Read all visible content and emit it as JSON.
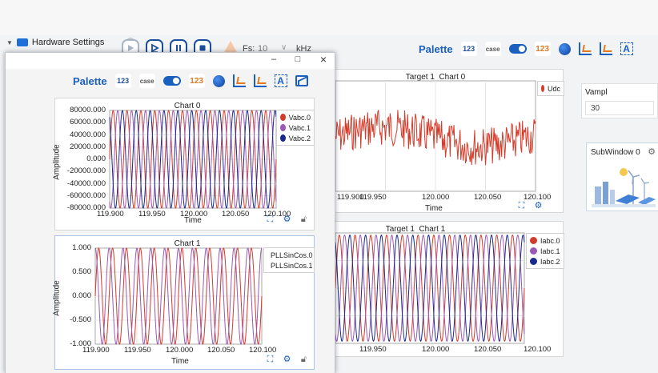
{
  "tree": {
    "label": "Hardware Settings"
  },
  "toolbar": {
    "fs_label": "Fs:",
    "fs_value": "10",
    "fs_unit": "kHz"
  },
  "palette": {
    "title": "Palette",
    "btn_123": "123",
    "btn_case": "case",
    "btn_123o": "123",
    "btn_text": "A"
  },
  "target_chart0": {
    "title": "Target 1_Chart 0",
    "legend": [
      {
        "name": "Udc",
        "color": "#d43b2a"
      }
    ],
    "xticks": [
      "119.900",
      "119.950",
      "120.000",
      "120.050",
      "120.100"
    ],
    "xlabel": "Time"
  },
  "target_chart1": {
    "title": "Target 1_Chart 1",
    "legend": [
      {
        "name": "Iabc.0",
        "color": "#d43b2a"
      },
      {
        "name": "Iabc.1",
        "color": "#9b59b6"
      },
      {
        "name": "Iabc.2",
        "color": "#1a2a8c"
      }
    ],
    "xticks": [
      "119.950",
      "120.000",
      "120.050",
      "120.100"
    ]
  },
  "vampl": {
    "label": "Vampl",
    "value": "30"
  },
  "subwindow": {
    "title": "SubWindow 0"
  },
  "fg_window": {
    "minimize": "–",
    "maximize": "□",
    "close": "×",
    "chart0": {
      "title": "Chart 0",
      "legend": [
        {
          "name": "Vabc.0",
          "color": "#d43b2a"
        },
        {
          "name": "Vabc.1",
          "color": "#9b59b6"
        },
        {
          "name": "Vabc.2",
          "color": "#1a2a8c"
        }
      ],
      "yticks": [
        "80000.000",
        "60000.000",
        "40000.000",
        "20000.000",
        "0.000",
        "-20000.000",
        "-40000.000",
        "-60000.000",
        "-80000.000"
      ],
      "xticks": [
        "119.900",
        "119.950",
        "120.000",
        "120.050",
        "120.100"
      ],
      "xlabel": "Time",
      "ylabel": "Amplitude"
    },
    "chart1": {
      "title": "Chart 1",
      "legend": [
        {
          "name": "PLLSinCos.0",
          "color": "#d43b2a"
        },
        {
          "name": "PLLSinCos.1",
          "color": "#9b59b6"
        }
      ],
      "yticks": [
        "1.000",
        "0.500",
        "0.000",
        "-0.500",
        "-1.000"
      ],
      "xticks": [
        "119.900",
        "119.950",
        "120.000",
        "120.050",
        "120.100"
      ],
      "xlabel": "Time",
      "ylabel": "Amplitude"
    }
  },
  "chart_data": [
    {
      "type": "line",
      "title": "Chart 0",
      "x_range": [
        119.9,
        120.1
      ],
      "ylim": [
        -80000,
        80000
      ],
      "xlabel": "Time",
      "ylabel": "Amplitude",
      "series": [
        {
          "name": "Vabc.0",
          "amplitude": 80000,
          "frequency_hz": 60,
          "phase_deg": 0
        },
        {
          "name": "Vabc.1",
          "amplitude": 80000,
          "frequency_hz": 60,
          "phase_deg": -120
        },
        {
          "name": "Vabc.2",
          "amplitude": 80000,
          "frequency_hz": 60,
          "phase_deg": 120
        }
      ],
      "grid": true,
      "legend": "top-right"
    },
    {
      "type": "line",
      "title": "Chart 1",
      "x_range": [
        119.9,
        120.1
      ],
      "ylim": [
        -1,
        1
      ],
      "xlabel": "Time",
      "ylabel": "Amplitude",
      "series": [
        {
          "name": "PLLSinCos.0",
          "amplitude": 1,
          "frequency_hz": 60,
          "phase_deg": 0
        },
        {
          "name": "PLLSinCos.1",
          "amplitude": 1,
          "frequency_hz": 60,
          "phase_deg": 90
        }
      ],
      "grid": true,
      "legend": "top-right"
    },
    {
      "type": "line",
      "title": "Target 1_Chart 0",
      "x_range": [
        119.9,
        120.1
      ],
      "xlabel": "Time",
      "series": [
        {
          "name": "Udc"
        }
      ],
      "grid": true,
      "legend": "top-right"
    },
    {
      "type": "line",
      "title": "Target 1_Chart 1",
      "x_range": [
        119.9,
        120.1
      ],
      "series": [
        {
          "name": "Iabc.0",
          "frequency_hz": 60,
          "phase_deg": 0
        },
        {
          "name": "Iabc.1",
          "frequency_hz": 60,
          "phase_deg": -120
        },
        {
          "name": "Iabc.2",
          "frequency_hz": 60,
          "phase_deg": 120
        }
      ],
      "grid": true,
      "legend": "top-right"
    }
  ]
}
